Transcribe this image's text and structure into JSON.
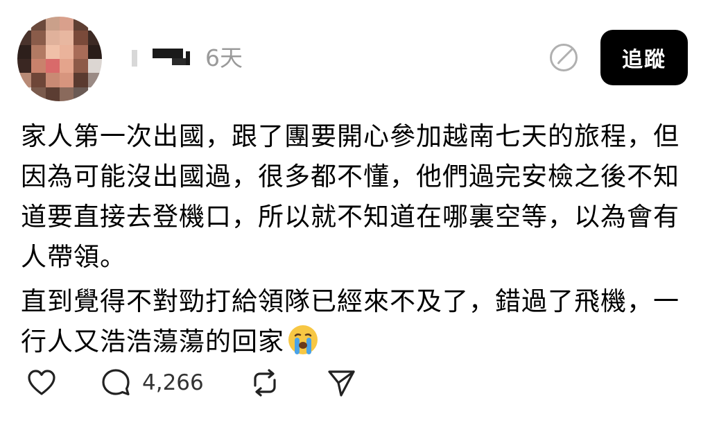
{
  "post": {
    "timestamp": "6天",
    "follow_label": "追蹤",
    "paragraphs": [
      "家人第一次出國，跟了團要開心參加越南七天的旅程，但因為可能沒出國過，很多都不懂，他們過完安檢之後不知道要直接去登機口，所以就不知道在哪裏空等，以為會有人帶領。",
      "直到覺得不對勁打給領隊已經來不及了，錯過了飛機，一行人又浩浩蕩蕩的回家"
    ],
    "emoji": "crying-face-emoji"
  },
  "actions": {
    "reply_count": "4,266",
    "icons": [
      "heart-icon",
      "comment-icon",
      "repost-icon",
      "share-icon"
    ]
  }
}
